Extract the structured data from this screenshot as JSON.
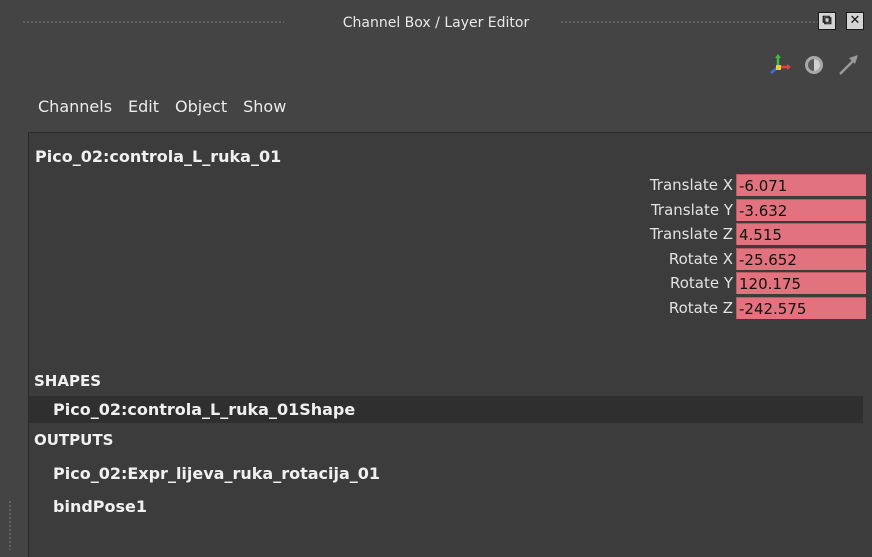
{
  "window": {
    "title": "Channel Box / Layer Editor",
    "float_button": "⧉",
    "close_button": "✕"
  },
  "toolbar_icons": [
    "axis-icon",
    "display-icon",
    "arrow-icon"
  ],
  "menu": [
    "Channels",
    "Edit",
    "Object",
    "Show"
  ],
  "object_name": "Pico_02:controla_L_ruka_01",
  "attributes": [
    {
      "label": "Translate X",
      "value": "-6.071"
    },
    {
      "label": "Translate Y",
      "value": "-3.632"
    },
    {
      "label": "Translate Z",
      "value": "4.515"
    },
    {
      "label": "Rotate X",
      "value": "-25.652"
    },
    {
      "label": "Rotate Y",
      "value": "120.175"
    },
    {
      "label": "Rotate Z",
      "value": "-242.575"
    }
  ],
  "shapes": {
    "heading": "SHAPES",
    "items": [
      "Pico_02:controla_L_ruka_01Shape"
    ]
  },
  "outputs": {
    "heading": "OUTPUTS",
    "items": [
      "Pico_02:Expr_lijeva_ruka_rotacija_01",
      "bindPose1"
    ]
  },
  "colors": {
    "background": "#444444",
    "panel": "#3c3c3c",
    "keyed_field": "#e2737e",
    "selected_row": "#2f2f2f"
  }
}
